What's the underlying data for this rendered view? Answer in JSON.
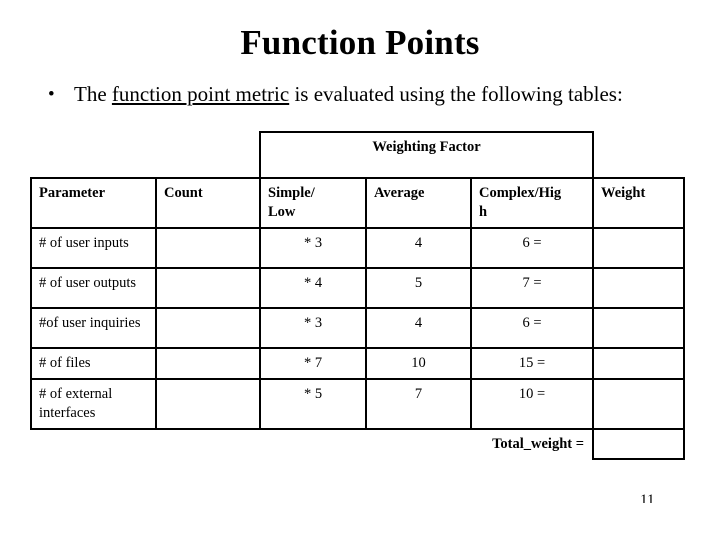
{
  "slide": {
    "title": "Function Points",
    "page_number": "11"
  },
  "bullet": {
    "marker": "•",
    "text_before": "The ",
    "emphasis": "function point metric",
    "text_after": " is evaluated using the following tables:"
  },
  "table": {
    "group_header": "Weighting Factor",
    "columns": [
      "Parameter",
      "Count",
      "Simple/ Low",
      "Average",
      "Complex/Hig h",
      "Weight"
    ],
    "column_simple_line1": "Simple/",
    "column_simple_line2": "Low",
    "column_complex_line1": "Complex/Hig",
    "column_complex_line2": "h",
    "rows": [
      {
        "parameter": "# of user inputs",
        "count": "",
        "simple_low": "* 3",
        "average": "4",
        "complex_high": "6 =",
        "weight": ""
      },
      {
        "parameter": "# of user outputs",
        "count": "",
        "simple_low": "*  4",
        "average": "5",
        "complex_high": "7 =",
        "weight": ""
      },
      {
        "parameter": "#of user inquiries",
        "count": "",
        "simple_low": "* 3",
        "average": "4",
        "complex_high": "6 =",
        "weight": ""
      },
      {
        "parameter": "# of files",
        "count": "",
        "simple_low": "* 7",
        "average": "10",
        "complex_high": "15 =",
        "weight": ""
      },
      {
        "parameter": "# of external interfaces",
        "count": "",
        "simple_low": "* 5",
        "average": "7",
        "complex_high": "10 =",
        "weight": ""
      }
    ],
    "total_label": "Total_weight =",
    "total_value": ""
  },
  "colors": {
    "background": "#ffffff",
    "text": "#000000",
    "border": "#000000"
  }
}
